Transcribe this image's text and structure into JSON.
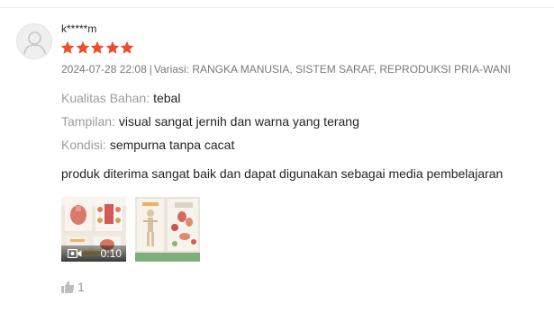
{
  "review": {
    "username": "k*****m",
    "rating": 5,
    "date": "2024-07-28 22:08",
    "separator": "|",
    "variation_label": "Variasi:",
    "variation_value": "RANGKA MANUSIA, SISTEM SARAF, REPRODUKSI PRIA-WANI, ...",
    "attributes": [
      {
        "label": "Kualitas Bahan",
        "colon": ":",
        "value": "tebal"
      },
      {
        "label": "Tampilan",
        "colon": ":",
        "value": "visual sangat jernih dan warna yang terang"
      },
      {
        "label": "Kondisi",
        "colon": ":",
        "value": "sempurna tanpa cacat"
      }
    ],
    "text": "produk diterima sangat baik dan dapat digunakan sebagai media pembelajaran",
    "media": [
      {
        "type": "video",
        "duration": "0:10"
      },
      {
        "type": "image"
      }
    ],
    "likes": "1"
  },
  "colors": {
    "star": "#ee4d2d",
    "muted_text": "rgba(0,0,0,0.54)",
    "label_text": "rgba(0,0,0,0.4)"
  },
  "icons": {
    "avatar": "user-placeholder-icon",
    "rating": "star-icon",
    "video": "video-camera-icon",
    "like": "thumbs-up-icon"
  }
}
